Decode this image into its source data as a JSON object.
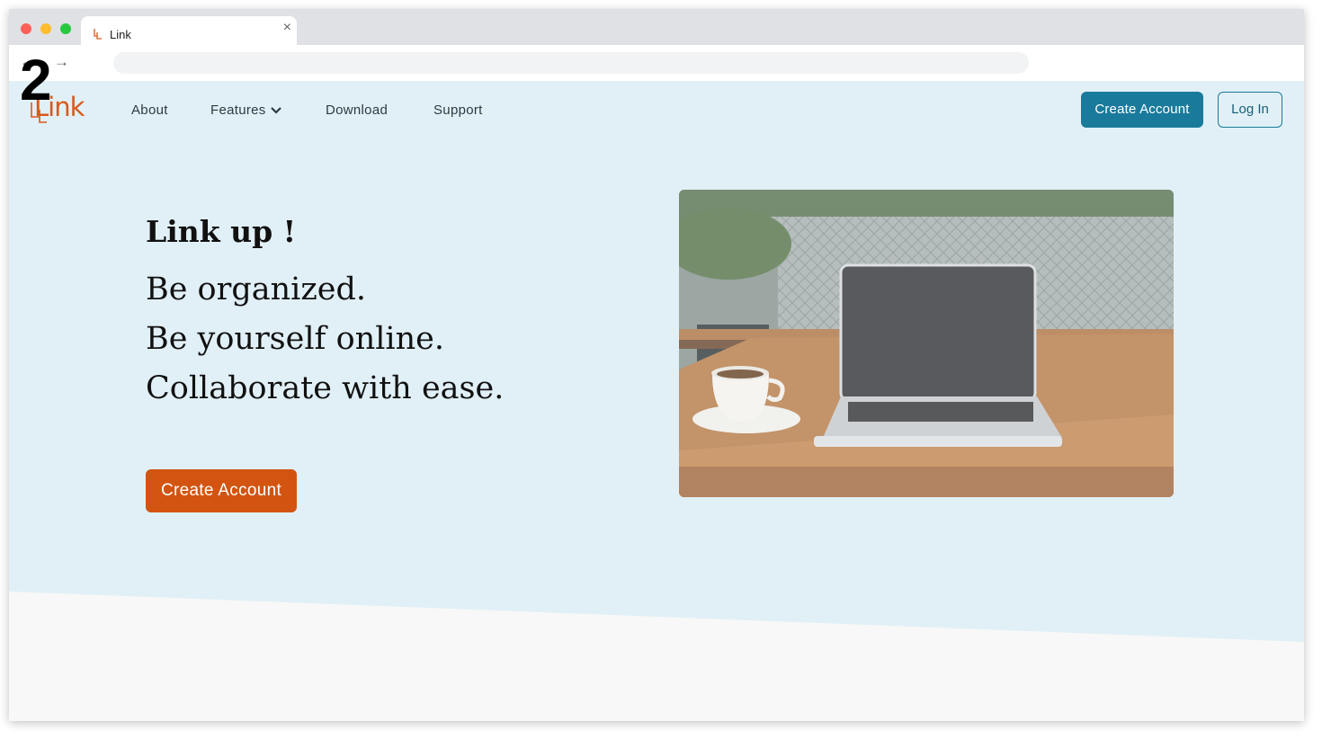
{
  "browser": {
    "tab_title": "Link",
    "back_glyph": "←",
    "forward_glyph": "→",
    "close_glyph": "×",
    "address_value": ""
  },
  "overlay": {
    "step_number": "2"
  },
  "site": {
    "logo_text": "Link",
    "nav": {
      "about": "About",
      "features": "Features",
      "download": "Download",
      "support": "Support"
    },
    "header_buttons": {
      "create_account": "Create Account",
      "log_in": "Log In"
    }
  },
  "hero": {
    "title": "Link up !",
    "lines": [
      "Be organized.",
      "Be yourself online.",
      "Collaborate with ease."
    ],
    "cta": "Create Account",
    "image_subject": "laptop and coffee cup on wooden table"
  },
  "icons": {
    "tab_favicon": "link-logo-icon",
    "features_dropdown": "chevron-down-icon",
    "back": "arrow-left-icon",
    "forward": "arrow-right-icon",
    "close": "close-icon"
  },
  "colors": {
    "accent_blue": "#1a7a9c",
    "accent_orange": "#d35410",
    "hero_bg": "#e1f0f6",
    "page_bg": "#f8f8f8"
  }
}
